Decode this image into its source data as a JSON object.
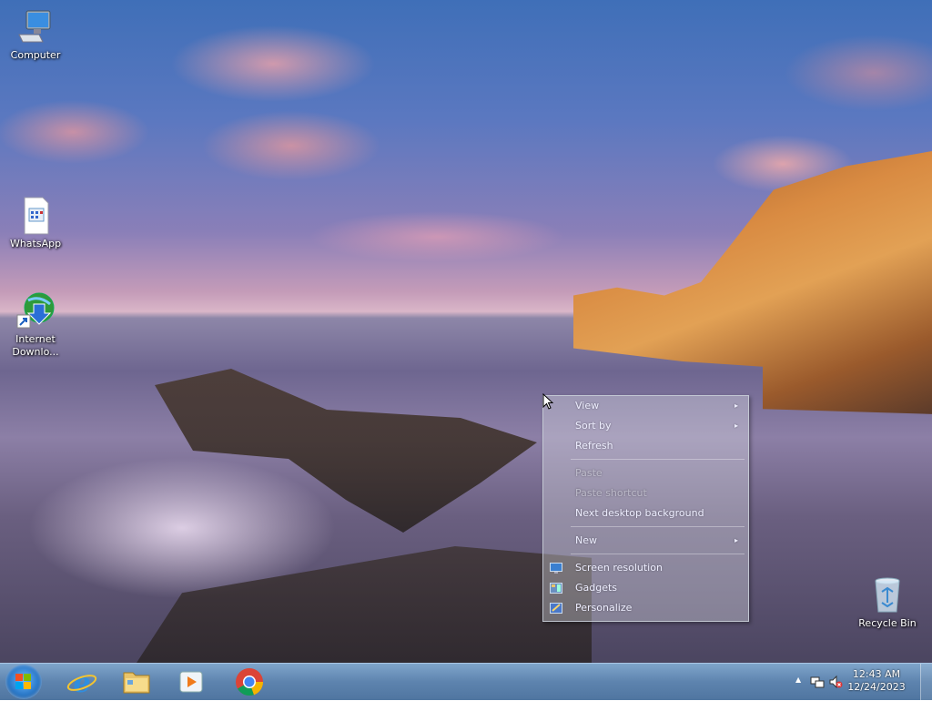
{
  "desktop": {
    "icons": [
      {
        "label": "Computer",
        "icon": "computer-icon"
      },
      {
        "label": "WhatsApp",
        "icon": "document-icon"
      },
      {
        "label_line1": "Internet",
        "label_line2": "Downlo...",
        "icon": "internet-download-manager-icon"
      },
      {
        "label": "Recycle Bin",
        "icon": "recycle-bin-icon"
      }
    ]
  },
  "context_menu": {
    "items": [
      {
        "label": "View",
        "submenu": true,
        "enabled": true
      },
      {
        "label": "Sort by",
        "submenu": true,
        "enabled": true
      },
      {
        "label": "Refresh",
        "enabled": true
      },
      {
        "label": "Paste",
        "enabled": false
      },
      {
        "label": "Paste shortcut",
        "enabled": false
      },
      {
        "label": "Next desktop background",
        "enabled": true
      },
      {
        "label": "New",
        "submenu": true,
        "enabled": true
      },
      {
        "label": "Screen resolution",
        "icon": "screen-resolution-icon",
        "enabled": true
      },
      {
        "label": "Gadgets",
        "icon": "gadgets-icon",
        "enabled": true
      },
      {
        "label": "Personalize",
        "icon": "personalize-icon",
        "enabled": true
      }
    ],
    "submenu_arrow": "▸"
  },
  "taskbar": {
    "pinned": [
      {
        "name": "internet-explorer",
        "icon": "internet-explorer-icon"
      },
      {
        "name": "file-explorer",
        "icon": "folder-icon"
      },
      {
        "name": "media-player",
        "icon": "media-player-icon"
      },
      {
        "name": "chrome",
        "icon": "chrome-icon"
      }
    ],
    "tray": {
      "show_hidden_glyph": "▲",
      "time": "12:43 AM",
      "date": "12/24/2023"
    }
  },
  "colors": {
    "taskbar": "#5f8fbf",
    "menu_text": "#eeeeff",
    "rocks": "#d98b42"
  }
}
